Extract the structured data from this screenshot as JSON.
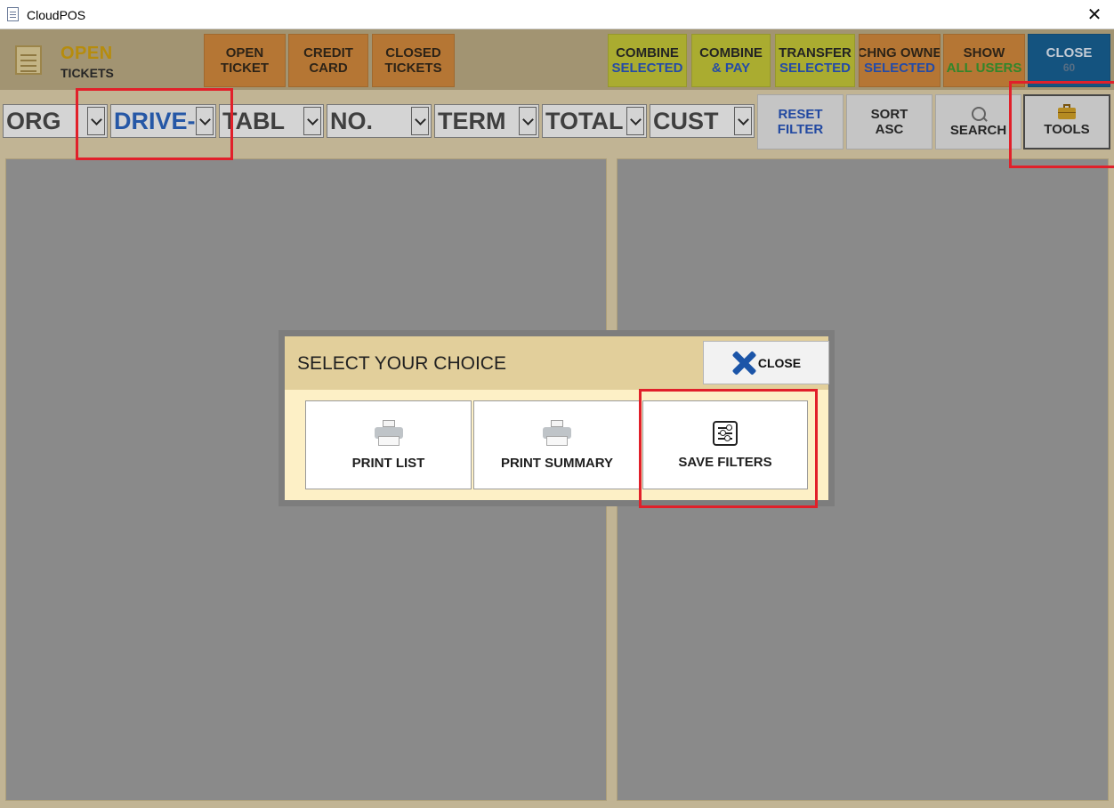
{
  "window": {
    "title": "CloudPOS",
    "close_glyph": "✕"
  },
  "header": {
    "logo_title": "OPEN",
    "logo_subtitle": "TICKETS",
    "logo_icon": "ticket-sheet-icon"
  },
  "toolbar": {
    "open_ticket": [
      "OPEN",
      "TICKET"
    ],
    "credit_card": [
      "CREDIT",
      "CARD"
    ],
    "closed_tickets": [
      "CLOSED",
      "TICKETS"
    ],
    "combine_selected": [
      "COMBINE",
      "SELECTED"
    ],
    "combine_pay": [
      "COMBINE",
      "& PAY"
    ],
    "transfer_selected": [
      "TRANSFER",
      "SELECTED"
    ],
    "chng_owner": [
      "CHNG OWNE",
      "SELECTED"
    ],
    "show_all_users": [
      "SHOW",
      "ALL USERS"
    ],
    "close": [
      "CLOSE",
      "60"
    ]
  },
  "filters": {
    "columns": [
      {
        "label": "ORG",
        "selected": false
      },
      {
        "label": "DRIVE-T",
        "selected": true
      },
      {
        "label": "TABL",
        "selected": false
      },
      {
        "label": "NO.",
        "selected": false
      },
      {
        "label": "TERM",
        "selected": false
      },
      {
        "label": "TOTAL",
        "selected": false
      },
      {
        "label": "CUST",
        "selected": false
      }
    ],
    "reset_filter": [
      "RESET",
      "FILTER"
    ],
    "sort": [
      "SORT",
      "ASC"
    ],
    "search": "SEARCH",
    "tools": "TOOLS"
  },
  "dialog": {
    "title": "SELECT YOUR CHOICE",
    "close_label": "CLOSE",
    "choices": [
      {
        "label": "PRINT LIST",
        "icon": "printer-icon"
      },
      {
        "label": "PRINT SUMMARY",
        "icon": "printer-icon"
      },
      {
        "label": "SAVE FILTERS",
        "icon": "sliders-icon"
      }
    ]
  },
  "colors": {
    "accent_orange": "#d88732",
    "accent_lime": "#c9cc2e",
    "close_blue": "#0a5a93",
    "highlight_red": "#e1202a",
    "selected_blue": "#1f5fc4"
  }
}
